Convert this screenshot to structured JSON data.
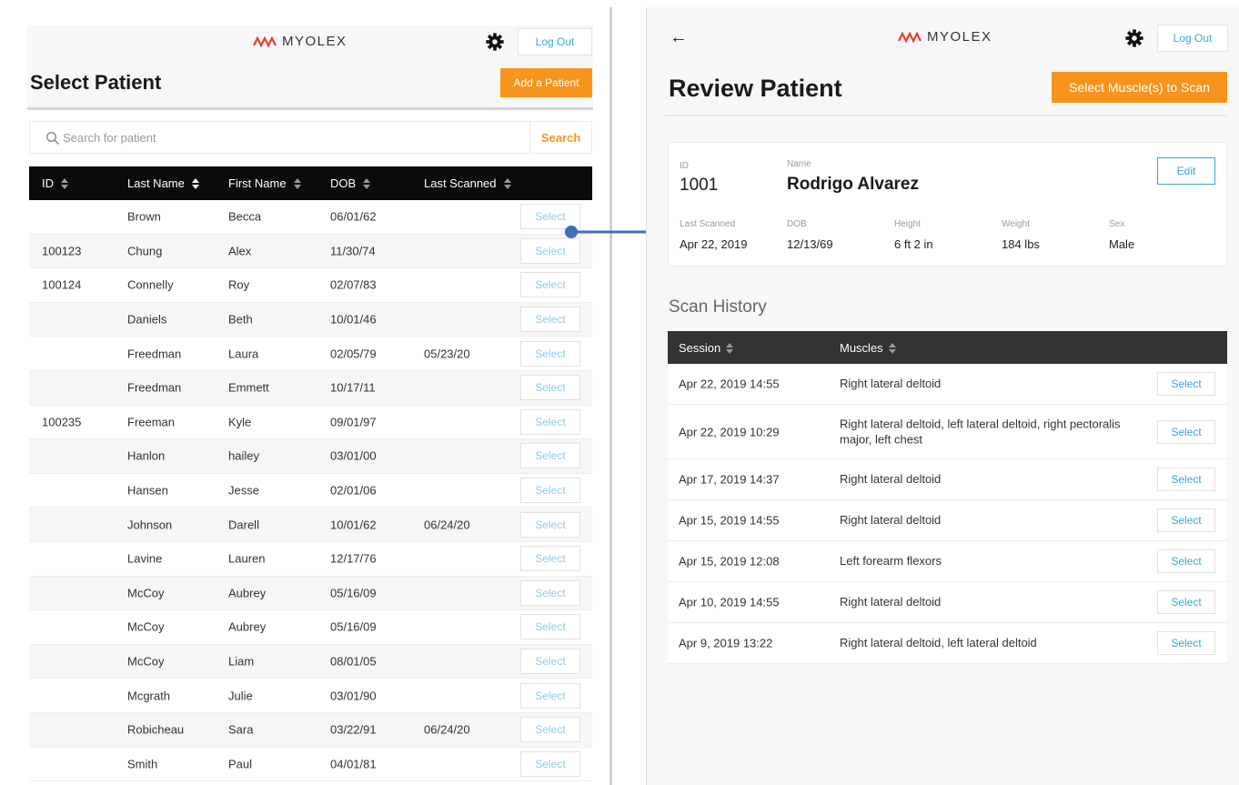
{
  "brand": {
    "name": "MYOLEX"
  },
  "colors": {
    "accent_orange": "#f7941d",
    "link_blue": "#3aa6d6",
    "header_black": "#0b0b0b"
  },
  "left": {
    "logout_label": "Log Out",
    "title": "Select Patient",
    "add_patient_label": "Add a Patient",
    "search": {
      "placeholder": "Search for patient",
      "button_label": "Search"
    },
    "columns": [
      "ID",
      "Last Name",
      "First Name",
      "DOB",
      "Last Scanned"
    ],
    "rows": [
      {
        "id": "",
        "last": "Brown",
        "first": "Becca",
        "dob": "06/01/62",
        "scanned": "",
        "action": "Select"
      },
      {
        "id": "100123",
        "last": "Chung",
        "first": "Alex",
        "dob": "11/30/74",
        "scanned": "",
        "action": "Select"
      },
      {
        "id": "100124",
        "last": "Connelly",
        "first": "Roy",
        "dob": "02/07/83",
        "scanned": "",
        "action": "Select"
      },
      {
        "id": "",
        "last": "Daniels",
        "first": "Beth",
        "dob": "10/01/46",
        "scanned": "",
        "action": "Select"
      },
      {
        "id": "",
        "last": "Freedman",
        "first": "Laura",
        "dob": "02/05/79",
        "scanned": "05/23/20",
        "action": "Select"
      },
      {
        "id": "",
        "last": "Freedman",
        "first": "Emmett",
        "dob": "10/17/11",
        "scanned": "",
        "action": "Select"
      },
      {
        "id": "100235",
        "last": "Freeman",
        "first": "Kyle",
        "dob": "09/01/97",
        "scanned": "",
        "action": "Select"
      },
      {
        "id": "",
        "last": "Hanlon",
        "first": "hailey",
        "dob": "03/01/00",
        "scanned": "",
        "action": "Select"
      },
      {
        "id": "",
        "last": "Hansen",
        "first": "Jesse",
        "dob": "02/01/06",
        "scanned": "",
        "action": "Select"
      },
      {
        "id": "",
        "last": "Johnson",
        "first": "Darell",
        "dob": "10/01/62",
        "scanned": "06/24/20",
        "action": "Select"
      },
      {
        "id": "",
        "last": "Lavine",
        "first": "Lauren",
        "dob": "12/17/76",
        "scanned": "",
        "action": "Select"
      },
      {
        "id": "",
        "last": "McCoy",
        "first": "Aubrey",
        "dob": "05/16/09",
        "scanned": "",
        "action": "Select"
      },
      {
        "id": "",
        "last": "McCoy",
        "first": "Aubrey",
        "dob": "05/16/09",
        "scanned": "",
        "action": "Select"
      },
      {
        "id": "",
        "last": "McCoy",
        "first": "Liam",
        "dob": "08/01/05",
        "scanned": "",
        "action": "Select"
      },
      {
        "id": "",
        "last": "Mcgrath",
        "first": "Julie",
        "dob": "03/01/90",
        "scanned": "",
        "action": "Select"
      },
      {
        "id": "",
        "last": "Robicheau",
        "first": "Sara",
        "dob": "03/22/91",
        "scanned": "06/24/20",
        "action": "Select"
      },
      {
        "id": "",
        "last": "Smith",
        "first": "Paul",
        "dob": "04/01/81",
        "scanned": "",
        "action": "Select"
      }
    ]
  },
  "right": {
    "logout_label": "Log Out",
    "title": "Review Patient",
    "select_scan_label": "Select Muscle(s) to Scan",
    "patient": {
      "id_label": "ID",
      "id": "1001",
      "name_label": "Name",
      "name": "Rodrigo Alvarez",
      "edit_label": "Edit",
      "last_scanned_label": "Last Scanned",
      "last_scanned": "Apr 22, 2019",
      "dob_label": "DOB",
      "dob": "12/13/69",
      "height_label": "Height",
      "height": "6 ft 2 in",
      "weight_label": "Weight",
      "weight": "184 lbs",
      "sex_label": "Sex",
      "sex": "Male"
    },
    "history_title": "Scan History",
    "columns": [
      "Session",
      "Muscles"
    ],
    "sessions": [
      {
        "session": "Apr 22, 2019 14:55",
        "muscles": "Right lateral deltoid",
        "action": "Select"
      },
      {
        "session": "Apr 22, 2019 10:29",
        "muscles": "Right lateral deltoid, left lateral deltoid, right pectoralis major, left chest",
        "action": "Select"
      },
      {
        "session": "Apr 17, 2019 14:37",
        "muscles": "Right lateral deltoid",
        "action": "Select"
      },
      {
        "session": "Apr 15, 2019 14:55",
        "muscles": "Right lateral deltoid",
        "action": "Select"
      },
      {
        "session": "Apr 15, 2019 12:08",
        "muscles": "Left forearm flexors",
        "action": "Select"
      },
      {
        "session": "Apr 10, 2019 14:55",
        "muscles": "Right lateral deltoid",
        "action": "Select"
      },
      {
        "session": "Apr 9, 2019 13:22",
        "muscles": "Right lateral deltoid, left lateral deltoid",
        "action": "Select"
      }
    ]
  }
}
